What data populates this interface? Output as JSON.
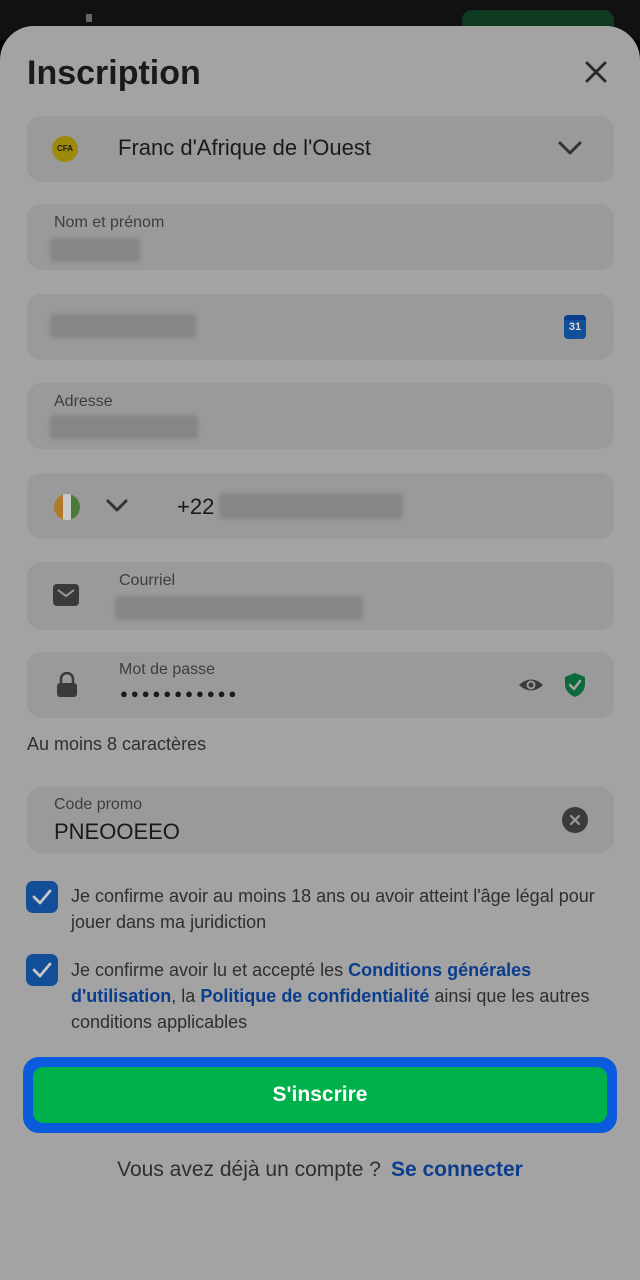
{
  "header": {
    "title": "Inscription"
  },
  "currency": {
    "icon_text": "CFA",
    "label": "Franc d'Afrique de l'Ouest"
  },
  "fields": {
    "fullname_label": "Nom et prénom",
    "address_label": "Adresse",
    "phone_prefix": "+22",
    "email_label": "Courriel",
    "password_label": "Mot de passe",
    "password_value": "●●●●●●●●●●●",
    "password_hint": "Au moins 8 caractères",
    "promo_label": "Code promo",
    "promo_value": "PNEOOEEO"
  },
  "calendar": {
    "day": "31"
  },
  "consents": {
    "age_text": "Je confirme avoir au moins 18 ans ou avoir atteint l'âge légal pour jouer dans ma juridiction",
    "terms_prefix": "Je confirme avoir lu et accepté les",
    "terms_link": "Conditions générales d'utilisation",
    "terms_mid": ", la",
    "privacy_link": "Politique de confidentialité",
    "terms_suffix": "ainsi que les autres conditions applicables"
  },
  "actions": {
    "register_label": "S'inscrire"
  },
  "footer": {
    "question": "Vous avez déjà un compte ?",
    "login_link": "Se connecter"
  },
  "colors": {
    "accent_green": "#00b04a",
    "focus_blue": "#0a5bdc",
    "link_blue": "#0b3d8d"
  }
}
